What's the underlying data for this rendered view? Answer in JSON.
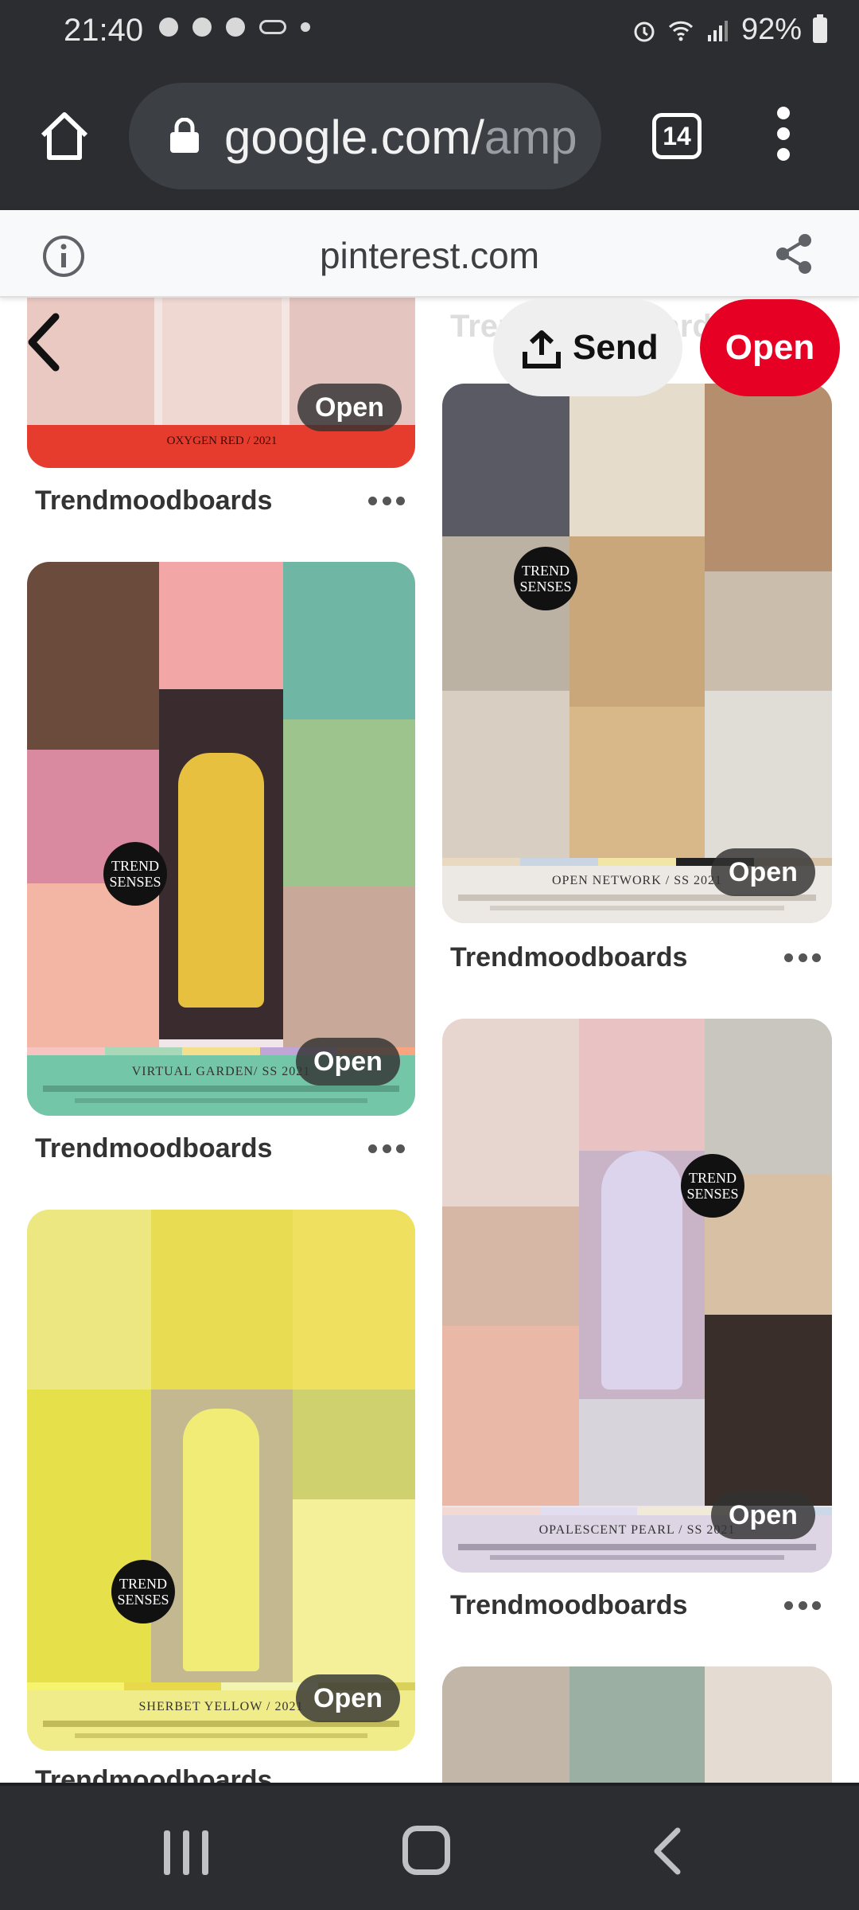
{
  "status_bar": {
    "time": "21:40",
    "battery": "92%",
    "icons": [
      "notification-icon",
      "notification-icon",
      "notification-icon",
      "voicemail-icon",
      "dot-icon",
      "alarm-icon",
      "wifi-icon",
      "signal-icon",
      "battery-icon"
    ]
  },
  "browser": {
    "url_main": "google.com/",
    "url_faded": "amp",
    "tab_count": "14"
  },
  "amp_header": {
    "title": "pinterest.com"
  },
  "overlay": {
    "send_label": "Send",
    "open_label": "Open",
    "faded_label": "Trendmoodboards"
  },
  "pins": [
    {
      "user": "Trendmoodboards",
      "open_label": "Open",
      "board_title": "OXYGEN RED / 2021"
    },
    {
      "user": "Trendmoodboards",
      "open_label": "Open",
      "board_title": "VIRTUAL GARDEN/ SS 2021"
    },
    {
      "user": "Trendmoodboards",
      "open_label": "Open",
      "board_title": "SHERBET YELLOW / 2021"
    },
    {
      "user": "Trendmoodboards",
      "open_label": "Open",
      "board_title": "OPEN NETWORK / SS 2021"
    },
    {
      "user": "Trendmoodboards",
      "open_label": "Open",
      "board_title": "OPALESCENT PEARL / SS 2021"
    },
    {
      "user": "Trendmoodboards",
      "open_label": "",
      "board_title": ""
    }
  ],
  "brand_badge": "TREND SENSES",
  "colors": {
    "pinterest_red": "#e60023",
    "chrome_dark": "#2b2d31"
  }
}
